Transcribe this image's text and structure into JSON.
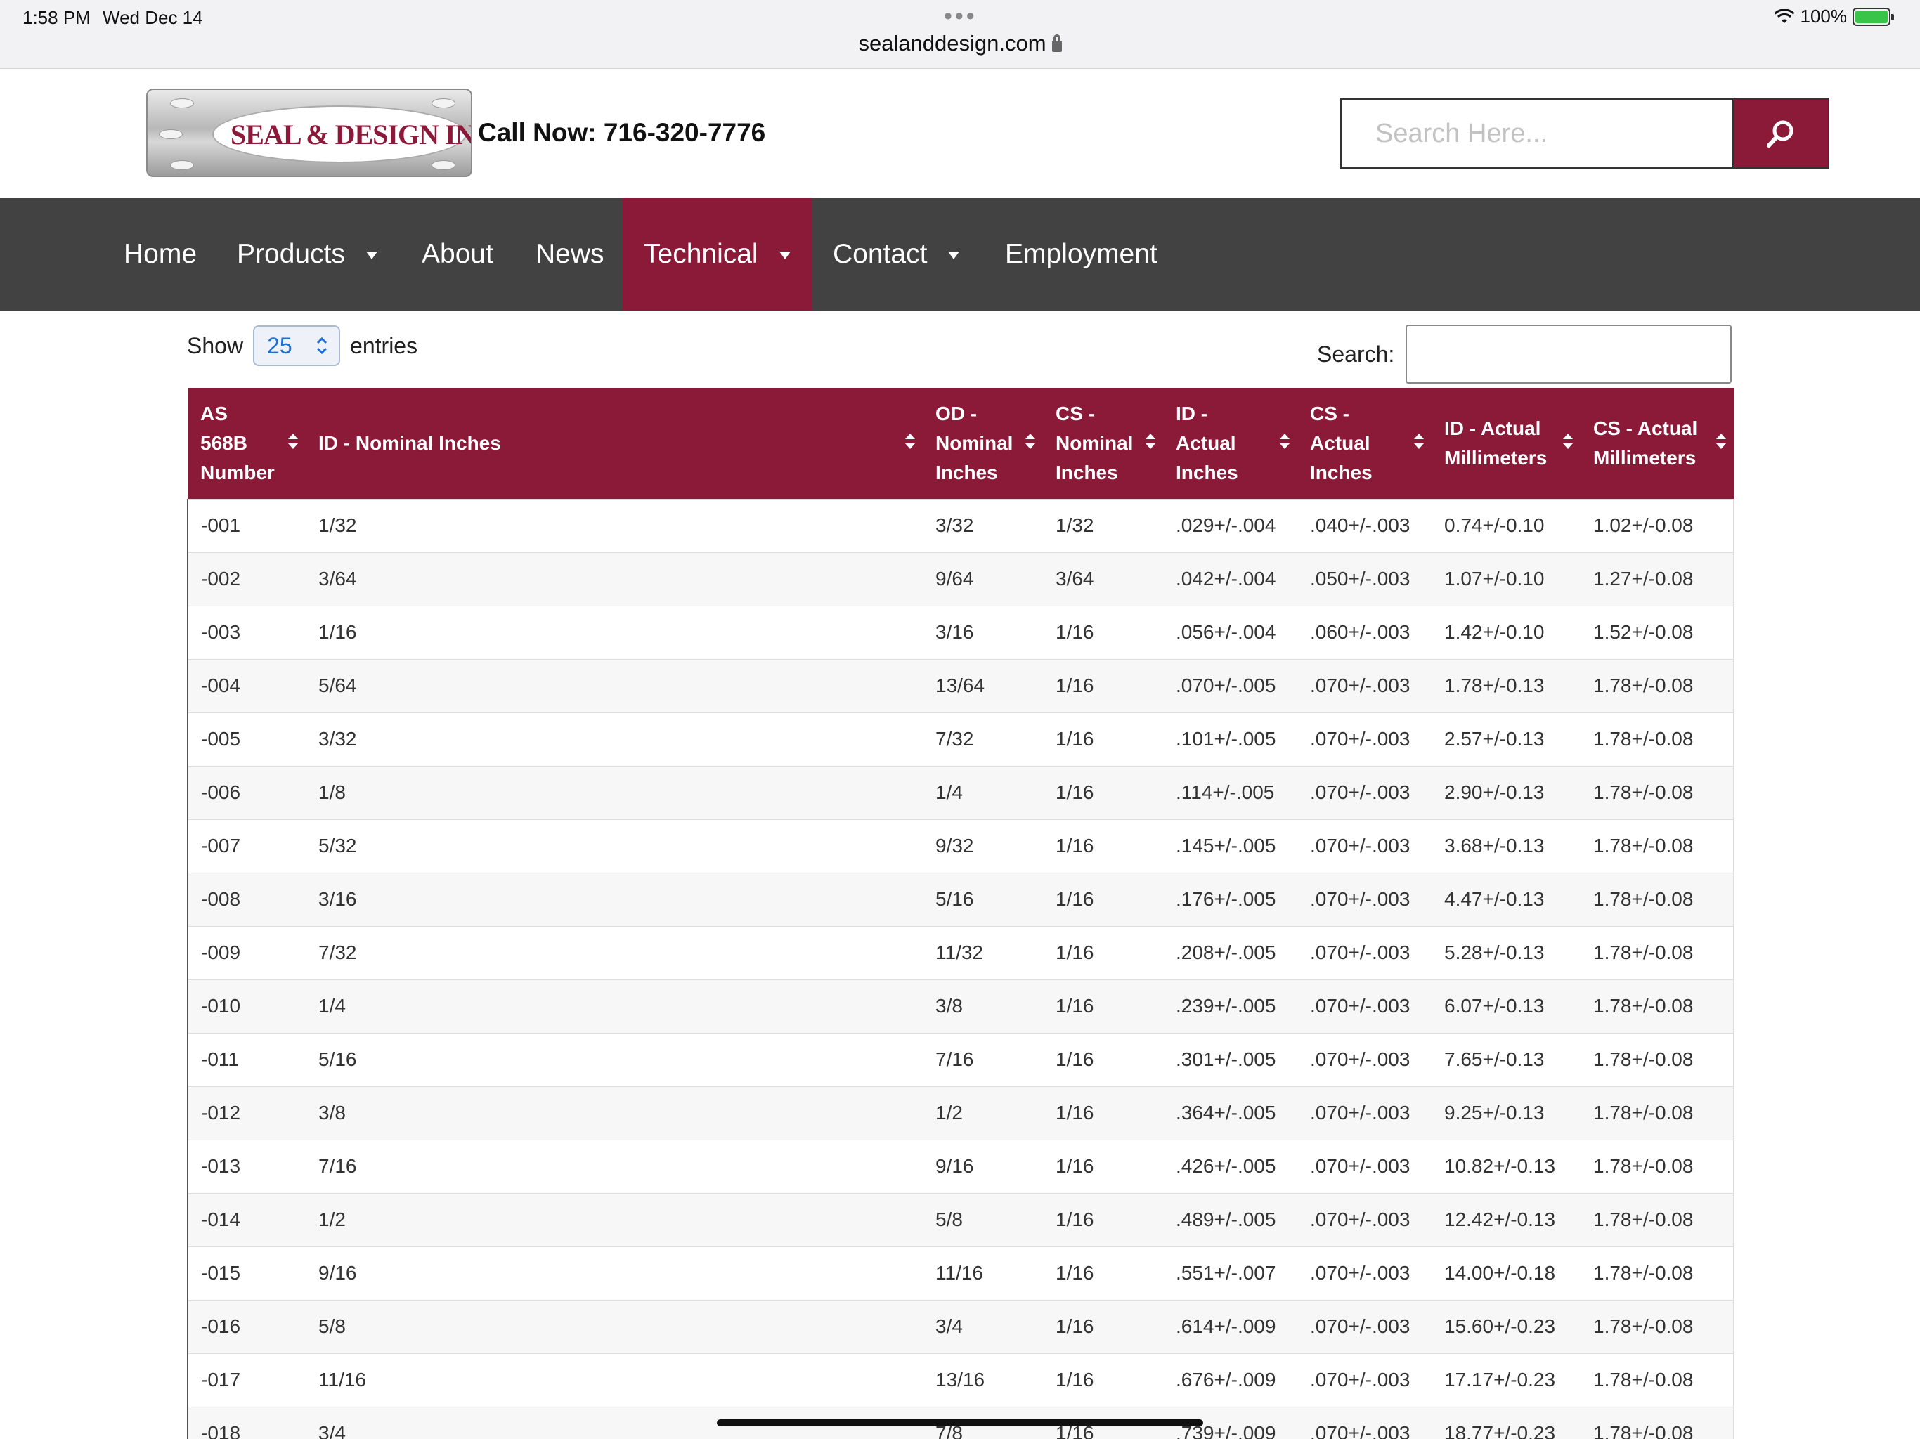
{
  "status_bar": {
    "time": "1:58 PM",
    "date": "Wed Dec 14",
    "url": "sealanddesign.com",
    "battery": "100%",
    "battery_level": 1.0
  },
  "header": {
    "logo_text": "SEAL & DESIGN INC.",
    "call_label": "Call Now:",
    "phone": "716-320-7776",
    "search_placeholder": "Search Here..."
  },
  "nav": {
    "items": [
      {
        "label": "Home"
      },
      {
        "label": "Products"
      },
      {
        "label": "About"
      },
      {
        "label": "News"
      },
      {
        "label": "Technical"
      },
      {
        "label": "Contact"
      },
      {
        "label": "Employment"
      }
    ]
  },
  "table_controls": {
    "show_label": "Show",
    "entries_value": "25",
    "entries_label": "entries",
    "search_label": "Search:",
    "search_value": ""
  },
  "table": {
    "columns": [
      "AS 568B Number",
      "ID - Nominal Inches",
      "OD - Nominal Inches",
      "CS - Nominal Inches",
      "ID - Actual Inches",
      "CS - Actual Inches",
      "ID - Actual Millimeters",
      "CS - Actual Millimeters"
    ],
    "rows": [
      [
        "-001",
        "1/32",
        "3/32",
        "1/32",
        ".029+/-.004",
        ".040+/-.003",
        "0.74+/-0.10",
        "1.02+/-0.08"
      ],
      [
        "-002",
        "3/64",
        "9/64",
        "3/64",
        ".042+/-.004",
        ".050+/-.003",
        "1.07+/-0.10",
        "1.27+/-0.08"
      ],
      [
        "-003",
        "1/16",
        "3/16",
        "1/16",
        ".056+/-.004",
        ".060+/-.003",
        "1.42+/-0.10",
        "1.52+/-0.08"
      ],
      [
        "-004",
        "5/64",
        "13/64",
        "1/16",
        ".070+/-.005",
        ".070+/-.003",
        "1.78+/-0.13",
        "1.78+/-0.08"
      ],
      [
        "-005",
        "3/32",
        "7/32",
        "1/16",
        ".101+/-.005",
        ".070+/-.003",
        "2.57+/-0.13",
        "1.78+/-0.08"
      ],
      [
        "-006",
        "1/8",
        "1/4",
        "1/16",
        ".114+/-.005",
        ".070+/-.003",
        "2.90+/-0.13",
        "1.78+/-0.08"
      ],
      [
        "-007",
        "5/32",
        "9/32",
        "1/16",
        ".145+/-.005",
        ".070+/-.003",
        "3.68+/-0.13",
        "1.78+/-0.08"
      ],
      [
        "-008",
        "3/16",
        "5/16",
        "1/16",
        ".176+/-.005",
        ".070+/-.003",
        "4.47+/-0.13",
        "1.78+/-0.08"
      ],
      [
        "-009",
        "7/32",
        "11/32",
        "1/16",
        ".208+/-.005",
        ".070+/-.003",
        "5.28+/-0.13",
        "1.78+/-0.08"
      ],
      [
        "-010",
        "1/4",
        "3/8",
        "1/16",
        ".239+/-.005",
        ".070+/-.003",
        "6.07+/-0.13",
        "1.78+/-0.08"
      ],
      [
        "-011",
        "5/16",
        "7/16",
        "1/16",
        ".301+/-.005",
        ".070+/-.003",
        "7.65+/-0.13",
        "1.78+/-0.08"
      ],
      [
        "-012",
        "3/8",
        "1/2",
        "1/16",
        ".364+/-.005",
        ".070+/-.003",
        "9.25+/-0.13",
        "1.78+/-0.08"
      ],
      [
        "-013",
        "7/16",
        "9/16",
        "1/16",
        ".426+/-.005",
        ".070+/-.003",
        "10.82+/-0.13",
        "1.78+/-0.08"
      ],
      [
        "-014",
        "1/2",
        "5/8",
        "1/16",
        ".489+/-.005",
        ".070+/-.003",
        "12.42+/-0.13",
        "1.78+/-0.08"
      ],
      [
        "-015",
        "9/16",
        "11/16",
        "1/16",
        ".551+/-.007",
        ".070+/-.003",
        "14.00+/-0.18",
        "1.78+/-0.08"
      ],
      [
        "-016",
        "5/8",
        "3/4",
        "1/16",
        ".614+/-.009",
        ".070+/-.003",
        "15.60+/-0.23",
        "1.78+/-0.08"
      ],
      [
        "-017",
        "11/16",
        "13/16",
        "1/16",
        ".676+/-.009",
        ".070+/-.003",
        "17.17+/-0.23",
        "1.78+/-0.08"
      ],
      [
        "-018",
        "3/4",
        "7/8",
        "1/16",
        ".739+/-.009",
        ".070+/-.003",
        "18.77+/-0.23",
        "1.78+/-0.08"
      ]
    ]
  },
  "colors": {
    "brand": "#8a1a38",
    "nav_bg": "#424242",
    "select_text": "#1a6fd9"
  }
}
